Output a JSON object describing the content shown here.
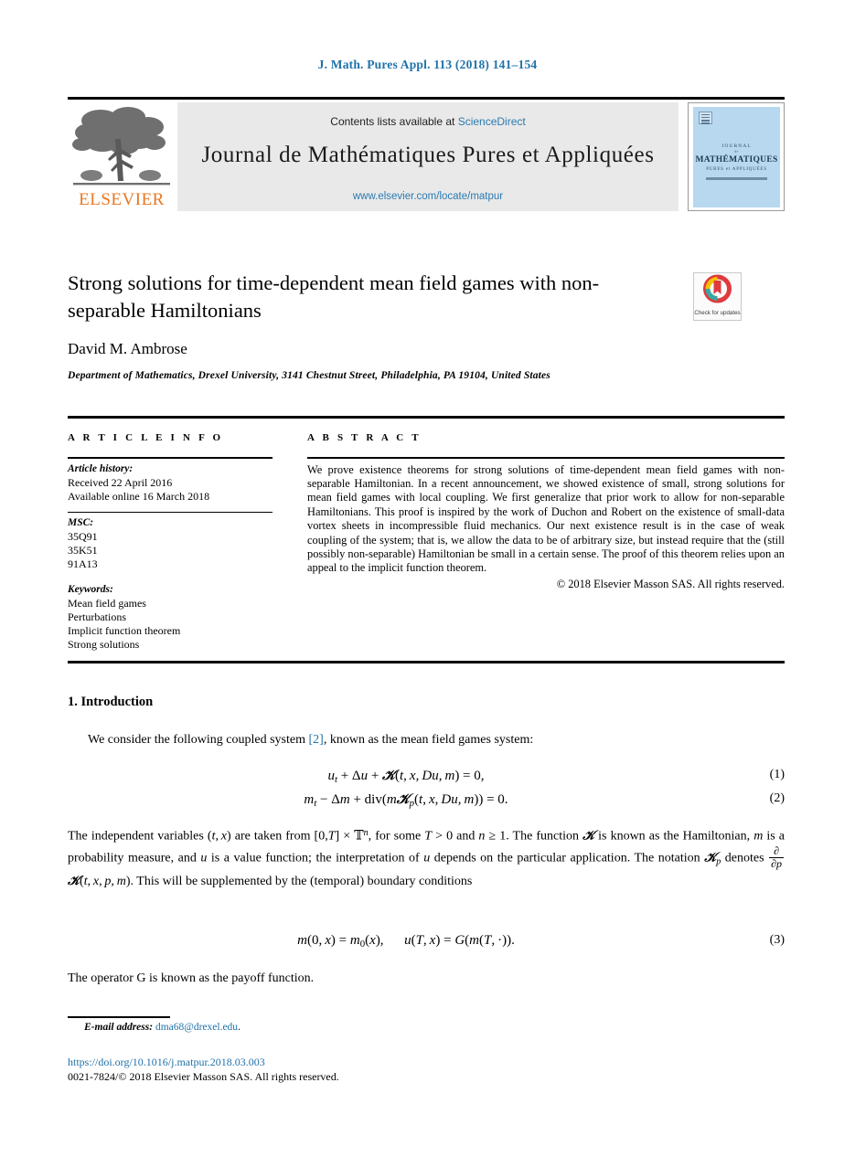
{
  "running_head": "J. Math. Pures Appl. 113 (2018) 141–154",
  "masthead": {
    "contents_prefix": "Contents lists available at ",
    "sciencedirect": "ScienceDirect",
    "journal_name": "Journal de Mathématiques Pures et Appliquées",
    "journal_url": "www.elsevier.com/locate/matpur",
    "publisher_wordmark": "ELSEVIER",
    "cover": {
      "line1": "JOURNAL",
      "line2": "de",
      "line3": "MATHÉMATIQUES",
      "line4": "PURES et APPLIQUÉES"
    }
  },
  "article": {
    "title": "Strong solutions for time-dependent mean field games with non-separable Hamiltonians",
    "author": "David M. Ambrose",
    "affiliation": "Department of Mathematics, Drexel University, 3141 Chestnut Street, Philadelphia, PA 19104, United States",
    "crossmark_label": "Check for updates"
  },
  "info": {
    "heading": "A R T I C L E   I N F O",
    "history_label": "Article history:",
    "history": [
      "Received 22 April 2016",
      "Available online 16 March 2018"
    ],
    "msc_label": "MSC:",
    "msc": [
      "35Q91",
      "35K51",
      "91A13"
    ],
    "keywords_label": "Keywords:",
    "keywords": [
      "Mean field games",
      "Perturbations",
      "Implicit function theorem",
      "Strong solutions"
    ]
  },
  "abstract": {
    "heading": "A B S T R A C T",
    "text": "We prove existence theorems for strong solutions of time-dependent mean field games with non-separable Hamiltonian. In a recent announcement, we showed existence of small, strong solutions for mean field games with local coupling. We first generalize that prior work to allow for non-separable Hamiltonians. This proof is inspired by the work of Duchon and Robert on the existence of small-data vortex sheets in incompressible fluid mechanics. Our next existence result is in the case of weak coupling of the system; that is, we allow the data to be of arbitrary size, but instead require that the (still possibly non-separable) Hamiltonian be small in a certain sense. The proof of this theorem relies upon an appeal to the implicit function theorem.",
    "copyright": "© 2018 Elsevier Masson SAS. All rights reserved."
  },
  "body": {
    "section_heading": "1.  Introduction",
    "para1_before": "We consider the following coupled system ",
    "citation": "[2]",
    "para1_after": ", known as the mean field games system:",
    "equations": {
      "eq1_number": "(1)",
      "eq2_number": "(2)",
      "eq3_number": "(3)"
    },
    "para2_a": "The independent variables ",
    "para2_b": " are taken from ",
    "para2_c": ", for some ",
    "para2_d": " and ",
    "para2_e": ". The function ",
    "para2_f": " is known as the Hamiltonian, ",
    "para2_g": " is a probability measure, and ",
    "para2_h": " is a value function; the interpretation of ",
    "para2_i": " depends on the particular application. The notation ",
    "para2_j": " denotes ",
    "para2_k": ". This will be supplemented by the (temporal) boundary conditions",
    "para3": "The operator G is known as the payoff function."
  },
  "footer": {
    "email_label": "E-mail address:",
    "email": "dma68@drexel.edu",
    "doi": "https://doi.org/10.1016/j.matpur.2018.03.003",
    "issn": "0021-7824/© 2018 Elsevier Masson SAS. All rights reserved."
  },
  "colors": {
    "link": "#1f72a8",
    "sciencedirect": "#2a7ab0",
    "elsevier_orange": "#e87722",
    "cover_blue": "#b8d8ef",
    "band_grey": "#e9e9e9"
  }
}
